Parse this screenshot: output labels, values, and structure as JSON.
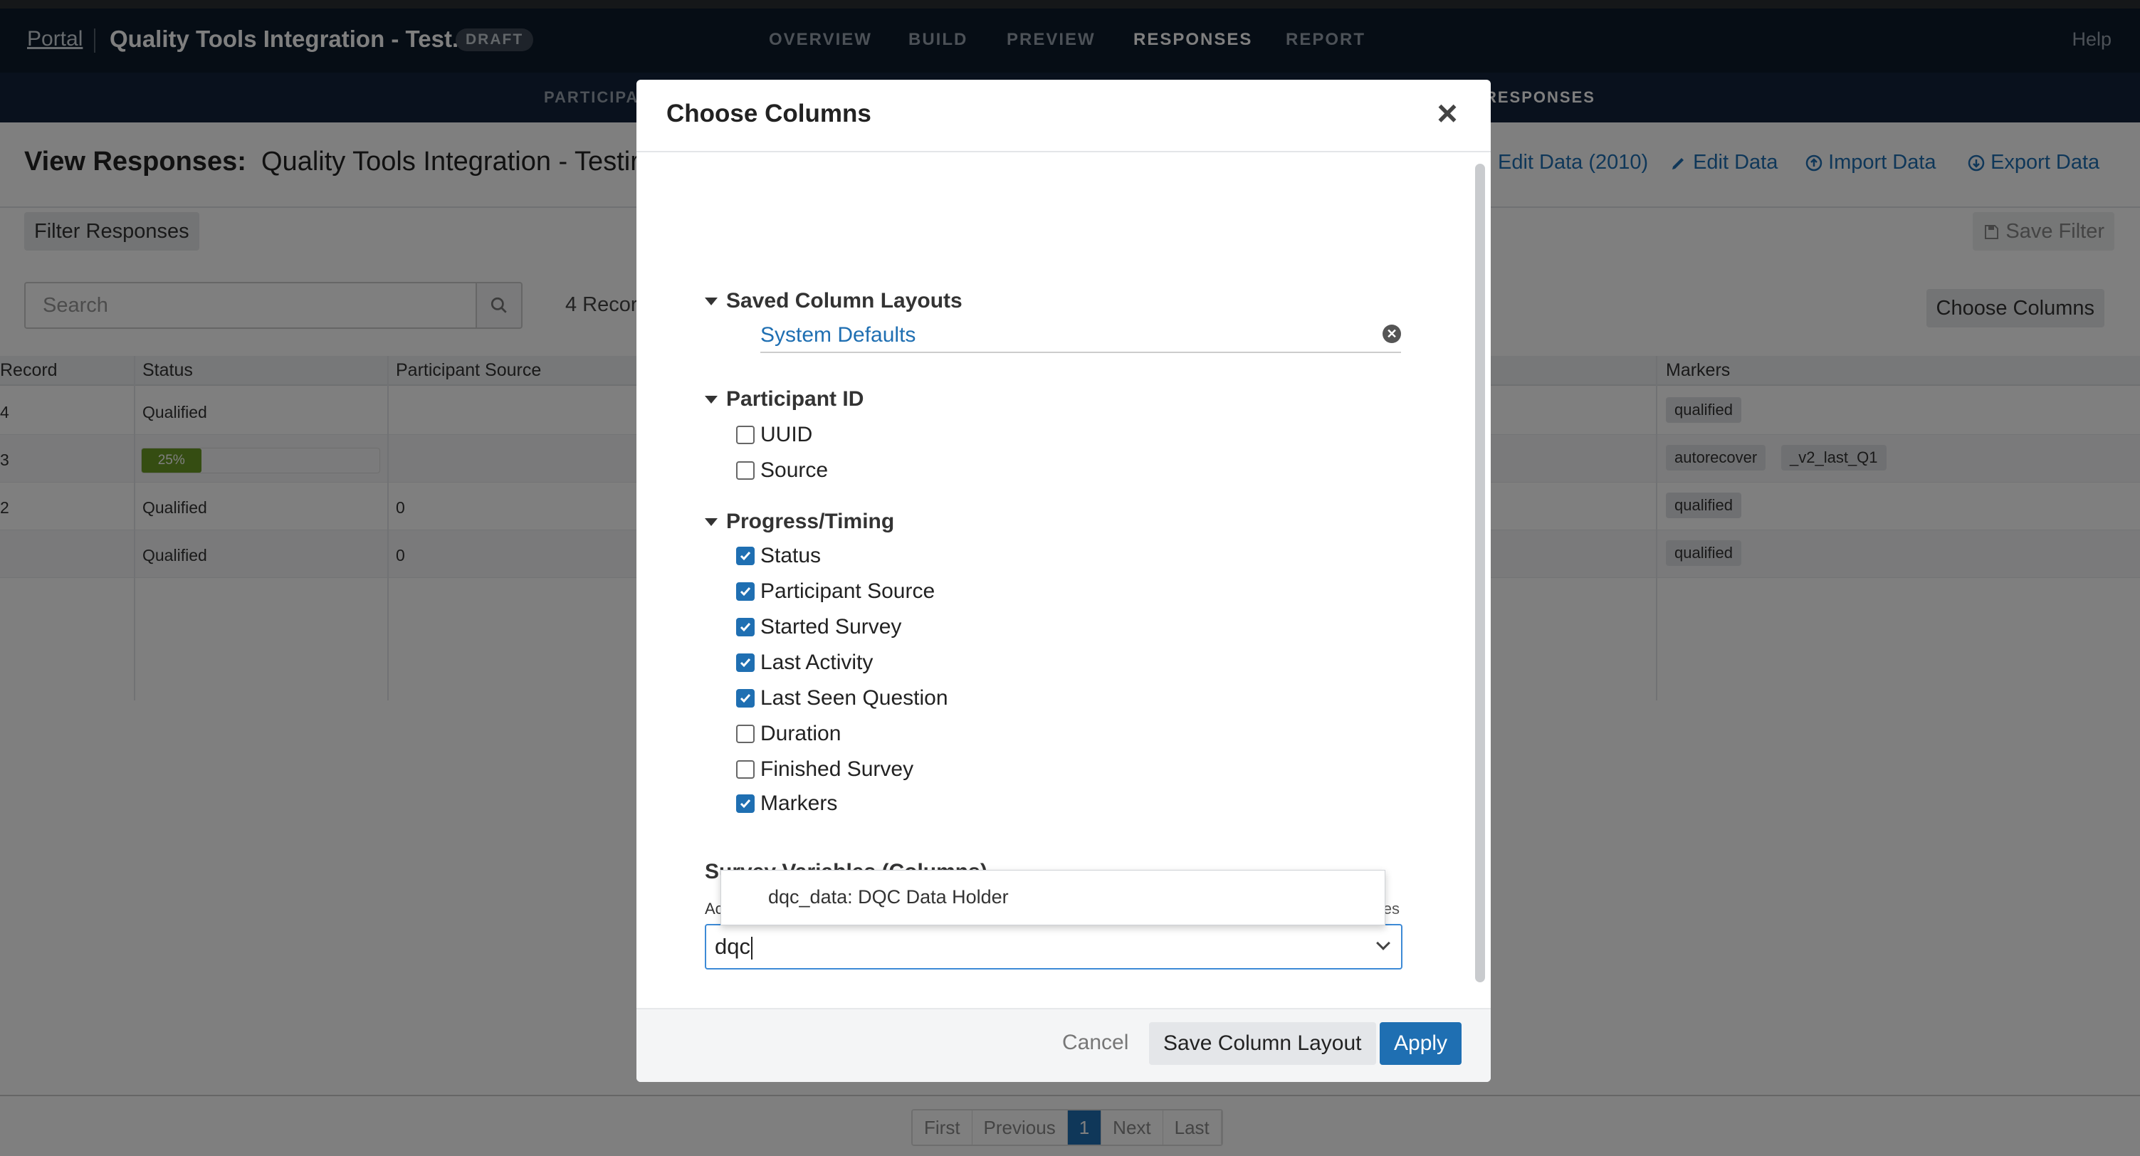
{
  "nav": {
    "portal": "Portal",
    "survey_title": "Quality Tools Integration - Test...",
    "badge": "DRAFT",
    "tabs": [
      "OVERVIEW",
      "BUILD",
      "PREVIEW",
      "RESPONSES",
      "REPORT"
    ],
    "active_tab": "RESPONSES",
    "help": "Help"
  },
  "subnav": {
    "left": "PARTICIPA",
    "right": "RESPONSES"
  },
  "page": {
    "heading_bold": "View Responses:",
    "heading_rest": "Quality Tools Integration - Testir",
    "actions": [
      "Edit Data (2010)",
      "Edit Data",
      "Import Data",
      "Export Data"
    ],
    "filter_button": "Filter Responses",
    "save_filter": "Save Filter",
    "search_placeholder": "Search",
    "record_count": "4 Recor",
    "choose_columns_button": "Choose Columns"
  },
  "table": {
    "headers": [
      "Record",
      "Status",
      "Participant Source",
      "Markers"
    ],
    "rows": [
      {
        "record": "4",
        "status": "Qualified",
        "source": "",
        "markers": [
          "qualified"
        ]
      },
      {
        "record": "3",
        "status": "",
        "progress_label": "25%",
        "progress": 0.25,
        "source": "",
        "markers": [
          "autorecover",
          "_v2_last_Q1"
        ]
      },
      {
        "record": "2",
        "status": "Qualified",
        "source": "0",
        "markers": [
          "qualified"
        ]
      },
      {
        "record": "",
        "status": "Qualified",
        "source": "0",
        "markers": [
          "qualified"
        ]
      }
    ]
  },
  "pagination": [
    "First",
    "Previous",
    "1",
    "Next",
    "Last"
  ],
  "modal": {
    "title": "Choose Columns",
    "close": "×",
    "sections": {
      "saved_layouts": {
        "label": "Saved Column Layouts",
        "item": "System Defaults"
      },
      "participant_id": {
        "label": "Participant ID",
        "items": [
          {
            "label": "UUID",
            "checked": false
          },
          {
            "label": "Source",
            "checked": false
          }
        ]
      },
      "progress_timing": {
        "label": "Progress/Timing",
        "items": [
          {
            "label": "Status",
            "checked": true
          },
          {
            "label": "Participant Source",
            "checked": true
          },
          {
            "label": "Started Survey",
            "checked": true
          },
          {
            "label": "Last Activity",
            "checked": true
          },
          {
            "label": "Last Seen Question",
            "checked": true
          },
          {
            "label": "Duration",
            "checked": false
          },
          {
            "label": "Finished Survey",
            "checked": false
          },
          {
            "label": "Markers",
            "checked": true
          }
        ]
      },
      "survey_variables": {
        "label": "Survey Variables (Columns)",
        "sub_left": "Ac",
        "sub_right": "es",
        "input_value": "dqc",
        "dropdown_option": "dqc_data: DQC Data Holder"
      }
    },
    "footer": {
      "cancel": "Cancel",
      "save_layout": "Save Column Layout",
      "apply": "Apply"
    }
  }
}
